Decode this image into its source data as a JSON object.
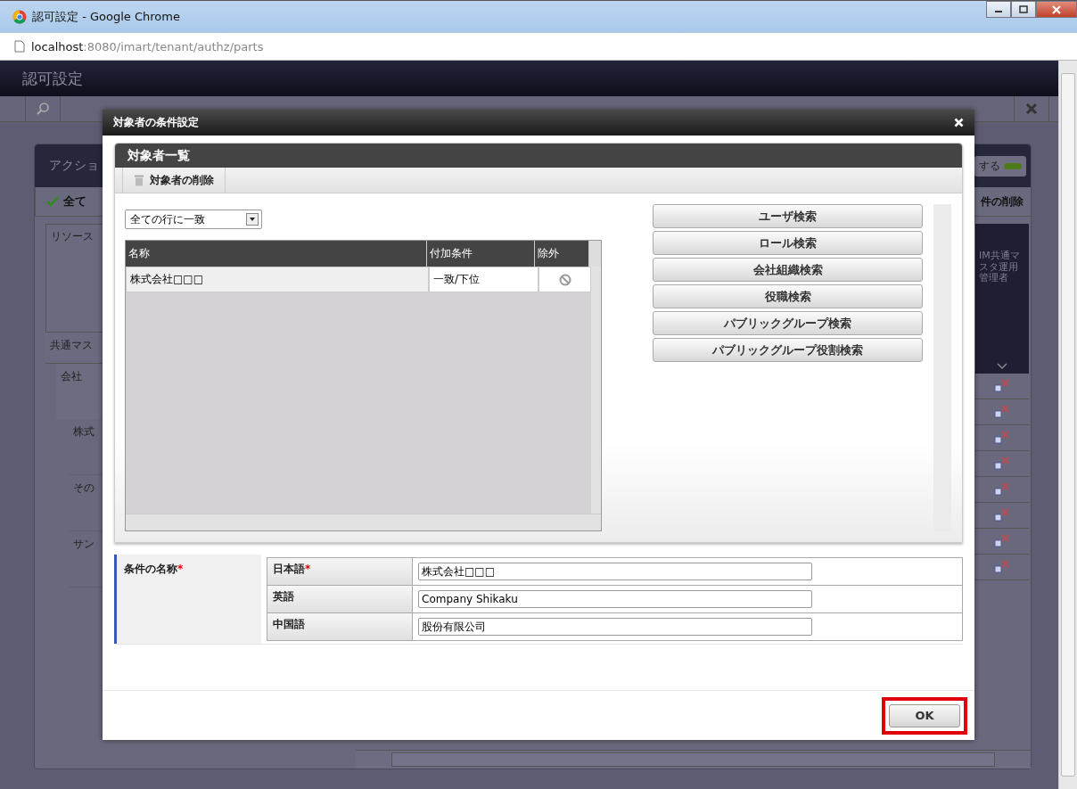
{
  "window": {
    "title": "認可設定 - Google Chrome"
  },
  "address_bar": {
    "host": "localhost",
    "path": ":8080/imart/tenant/authz/parts"
  },
  "page": {
    "title": "認可設定",
    "panel_title": "アクショ",
    "toggle_label": "する",
    "toggle_on": true,
    "toolbar_left": "全て",
    "toolbar_right": "件の削除",
    "tree_header": "リソース",
    "tree": [
      {
        "label": "共通マス",
        "children": [
          {
            "label": "会社",
            "children": [
              {
                "label": "株式"
              },
              {
                "label": "その"
              },
              {
                "label": "サン"
              }
            ]
          }
        ]
      }
    ],
    "column_header": "IM共通マスタ運用管理者"
  },
  "dialog": {
    "title": "対象者の条件設定",
    "section_title": "対象者一覧",
    "delete_button": "対象者の削除",
    "match_select": "全ての行に一致",
    "table": {
      "columns": [
        "名称",
        "付加条件",
        "除外"
      ],
      "rows": [
        {
          "name": "株式会社□□□",
          "condition": "一致/下位"
        }
      ]
    },
    "search_buttons": [
      "ユーザ検索",
      "ロール検索",
      "会社組織検索",
      "役職検索",
      "パブリックグループ検索",
      "パブリックグループ役割検索"
    ],
    "name_field": {
      "label": "条件の名称",
      "required_mark": "*",
      "languages": [
        {
          "label": "日本語",
          "required_mark": "*",
          "value": "株式会社□□□"
        },
        {
          "label": "英語",
          "value": "Company Shikaku"
        },
        {
          "label": "中国語",
          "value": "股份有限公司"
        }
      ]
    },
    "ok_button": "OK",
    "ok_highlighted": true
  }
}
